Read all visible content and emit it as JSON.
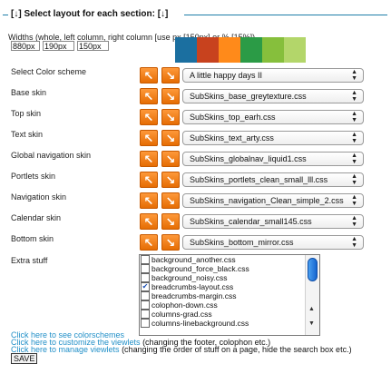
{
  "legend": "[↓] Select layout for each section: [↓]",
  "widths": {
    "label": "Widths (whole, left column, right column [use px [150px] or % [15%])",
    "values": [
      "880px",
      "190px",
      "150px"
    ]
  },
  "color_swatches": [
    "#1b6fa0",
    "#c8421e",
    "#ff8a1a",
    "#2b9b46",
    "#86bf3c",
    "#b3d66a"
  ],
  "arrow_left_label": "↖",
  "arrow_right_label": "↘",
  "rows": [
    {
      "label": "Select Color scheme",
      "value": "A little happy days II"
    },
    {
      "label": "Base skin",
      "value": "SubSkins_base_greytexture.css"
    },
    {
      "label": "Top skin",
      "value": "SubSkins_top_earh.css"
    },
    {
      "label": "Text skin",
      "value": "SubSkins_text_arty.css"
    },
    {
      "label": "Global navigation skin",
      "value": "SubSkins_globalnav_liquid1.css"
    },
    {
      "label": "Portlets skin",
      "value": "SubSkins_portlets_clean_small_lll.css"
    },
    {
      "label": "Navigation skin",
      "value": "SubSkins_navigation_Clean_simple_2.css"
    },
    {
      "label": "Calendar skin",
      "value": "SubSkins_calendar_small145.css"
    },
    {
      "label": "Bottom skin",
      "value": "SubSkins_bottom_mirror.css"
    }
  ],
  "extra": {
    "label": "Extra stuff",
    "items": [
      {
        "name": "background_another.css",
        "checked": false
      },
      {
        "name": "background_force_black.css",
        "checked": false
      },
      {
        "name": "background_noisy.css",
        "checked": false
      },
      {
        "name": "breadcrumbs-layout.css",
        "checked": true
      },
      {
        "name": "breadcrumbs-margin.css",
        "checked": false
      },
      {
        "name": "colophon-down.css",
        "checked": false
      },
      {
        "name": "columns-grad.css",
        "checked": false
      },
      {
        "name": "columns-linebackground.css",
        "checked": false
      }
    ]
  },
  "links": [
    {
      "link": "Click here to see colorschemes",
      "rest": ""
    },
    {
      "link": "Click here to customize the viewlets",
      "rest": " (changing the footer, colophon etc.)"
    },
    {
      "link": "Click here to manage viewlets",
      "rest": " (changing the order of stuff on a page, hide the search box etc.)"
    }
  ],
  "save_label": "SAVE"
}
